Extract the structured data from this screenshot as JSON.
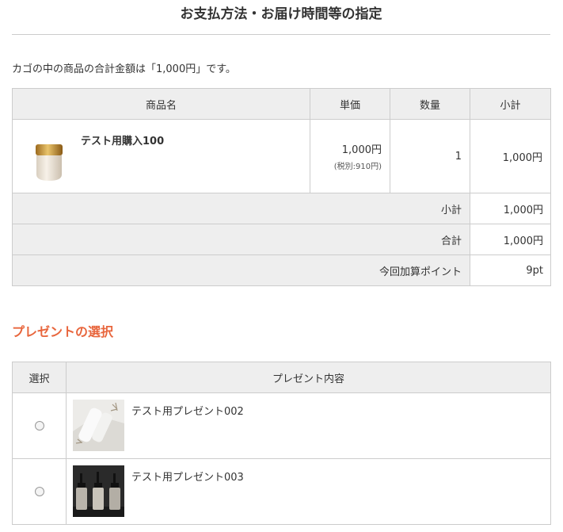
{
  "page_title": "お支払方法・お届け時間等の指定",
  "summary_text": "カゴの中の商品の合計金額は「1,000円」です。",
  "cart": {
    "headers": {
      "product": "商品名",
      "unit_price": "単価",
      "quantity": "数量",
      "subtotal": "小計"
    },
    "item": {
      "name": "テスト用購入100",
      "price": "1,000円",
      "price_ex_tax": "(税別:910円)",
      "quantity": "1",
      "subtotal": "1,000円",
      "image_icon": "cream-jar-icon"
    },
    "summary_rows": [
      {
        "label": "小計",
        "value": "1,000円"
      },
      {
        "label": "合計",
        "value": "1,000円"
      },
      {
        "label": "今回加算ポイント",
        "value": "9pt"
      }
    ]
  },
  "present_section": {
    "title": "プレゼントの選択",
    "headers": {
      "select": "選択",
      "content": "プレゼント内容"
    },
    "items": [
      {
        "name": "テスト用プレゼント002",
        "selected": false,
        "image_icon": "white-tubes-icon"
      },
      {
        "name": "テスト用プレゼント003",
        "selected": false,
        "image_icon": "pump-bottles-icon"
      }
    ]
  },
  "colors": {
    "accent": "#e8663d",
    "header_bg": "#eeeeee",
    "border": "#cccccc"
  }
}
